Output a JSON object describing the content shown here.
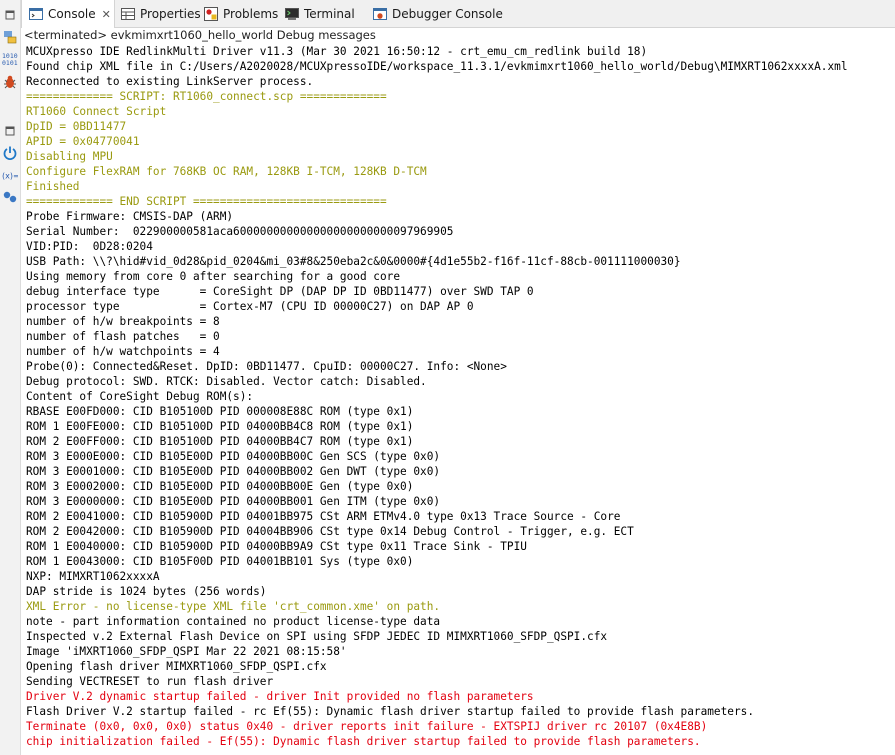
{
  "tabs": [
    {
      "label": "Console",
      "icon": "console-icon",
      "active": true
    },
    {
      "label": "Properties",
      "icon": "properties-icon"
    },
    {
      "label": "Problems",
      "icon": "problems-icon"
    },
    {
      "label": "Terminal",
      "icon": "terminal-icon"
    },
    {
      "label": "Debugger Console",
      "icon": "debugger-console-icon"
    }
  ],
  "console_title": "<terminated> evkmimxrt1060_hello_world Debug messages",
  "left_toolbar_icons": [
    "minimize-icon",
    "project-explorer-icon",
    "registers-icon",
    "debug-bug-icon",
    "minimize-icon",
    "power-icon",
    "variables-icon",
    "breakpoints-icon"
  ],
  "colors": {
    "normal": "#000000",
    "script": "#9a9a10",
    "error": "#e3000f"
  },
  "lines": [
    {
      "t": "MCUXpresso IDE RedlinkMulti Driver v11.3 (Mar 30 2021 16:50:12 - crt_emu_cm_redlink build 18)",
      "c": "normal"
    },
    {
      "t": "Found chip XML file in C:/Users/A2020028/MCUXpressoIDE/workspace_11.3.1/evkmimxrt1060_hello_world/Debug\\MIMXRT1062xxxxA.xml",
      "c": "normal"
    },
    {
      "t": "Reconnected to existing LinkServer process.",
      "c": "normal"
    },
    {
      "t": "============= SCRIPT: RT1060_connect.scp =============",
      "c": "script"
    },
    {
      "t": "RT1060 Connect Script",
      "c": "script"
    },
    {
      "t": "DpID = 0BD11477",
      "c": "script"
    },
    {
      "t": "APID = 0x04770041",
      "c": "script"
    },
    {
      "t": "Disabling MPU",
      "c": "script"
    },
    {
      "t": "Configure FlexRAM for 768KB OC RAM, 128KB I-TCM, 128KB D-TCM",
      "c": "script"
    },
    {
      "t": "Finished",
      "c": "script"
    },
    {
      "t": "============= END SCRIPT =============================",
      "c": "script"
    },
    {
      "t": "Probe Firmware: CMSIS-DAP (ARM)",
      "c": "normal"
    },
    {
      "t": "Serial Number:  022900000581aca600000000000000000000000097969905",
      "c": "normal"
    },
    {
      "t": "VID:PID:  0D28:0204",
      "c": "normal"
    },
    {
      "t": "USB Path: \\\\?\\hid#vid_0d28&pid_0204&mi_03#8&250eba2c&0&0000#{4d1e55b2-f16f-11cf-88cb-001111000030}",
      "c": "normal"
    },
    {
      "t": "Using memory from core 0 after searching for a good core",
      "c": "normal"
    },
    {
      "t": "debug interface type      = CoreSight DP (DAP DP ID 0BD11477) over SWD TAP 0",
      "c": "normal"
    },
    {
      "t": "processor type            = Cortex-M7 (CPU ID 00000C27) on DAP AP 0",
      "c": "normal"
    },
    {
      "t": "number of h/w breakpoints = 8",
      "c": "normal"
    },
    {
      "t": "number of flash patches   = 0",
      "c": "normal"
    },
    {
      "t": "number of h/w watchpoints = 4",
      "c": "normal"
    },
    {
      "t": "Probe(0): Connected&Reset. DpID: 0BD11477. CpuID: 00000C27. Info: <None>",
      "c": "normal"
    },
    {
      "t": "Debug protocol: SWD. RTCK: Disabled. Vector catch: Disabled.",
      "c": "normal"
    },
    {
      "t": "Content of CoreSight Debug ROM(s):",
      "c": "normal"
    },
    {
      "t": "RBASE E00FD000: CID B105100D PID 000008E88C ROM (type 0x1)",
      "c": "normal"
    },
    {
      "t": "ROM 1 E00FE000: CID B105100D PID 04000BB4C8 ROM (type 0x1)",
      "c": "normal"
    },
    {
      "t": "ROM 2 E00FF000: CID B105100D PID 04000BB4C7 ROM (type 0x1)",
      "c": "normal"
    },
    {
      "t": "ROM 3 E000E000: CID B105E00D PID 04000BB00C Gen SCS (type 0x0)",
      "c": "normal"
    },
    {
      "t": "ROM 3 E0001000: CID B105E00D PID 04000BB002 Gen DWT (type 0x0)",
      "c": "normal"
    },
    {
      "t": "ROM 3 E0002000: CID B105E00D PID 04000BB00E Gen (type 0x0)",
      "c": "normal"
    },
    {
      "t": "ROM 3 E0000000: CID B105E00D PID 04000BB001 Gen ITM (type 0x0)",
      "c": "normal"
    },
    {
      "t": "ROM 2 E0041000: CID B105900D PID 04001BB975 CSt ARM ETMv4.0 type 0x13 Trace Source - Core",
      "c": "normal"
    },
    {
      "t": "ROM 2 E0042000: CID B105900D PID 04004BB906 CSt type 0x14 Debug Control - Trigger, e.g. ECT",
      "c": "normal"
    },
    {
      "t": "ROM 1 E0040000: CID B105900D PID 04000BB9A9 CSt type 0x11 Trace Sink - TPIU",
      "c": "normal"
    },
    {
      "t": "ROM 1 E0043000: CID B105F00D PID 04001BB101 Sys (type 0x0)",
      "c": "normal"
    },
    {
      "t": "NXP: MIMXRT1062xxxxA",
      "c": "normal"
    },
    {
      "t": "DAP stride is 1024 bytes (256 words)",
      "c": "normal"
    },
    {
      "t": "XML Error - no license-type XML file 'crt_common.xme' on path.",
      "c": "script"
    },
    {
      "t": "note - part information contained no product license-type data",
      "c": "normal"
    },
    {
      "t": "Inspected v.2 External Flash Device on SPI using SFDP JEDEC ID MIMXRT1060_SFDP_QSPI.cfx",
      "c": "normal"
    },
    {
      "t": "Image 'iMXRT1060_SFDP_QSPI Mar 22 2021 08:15:58'",
      "c": "normal"
    },
    {
      "t": "Opening flash driver MIMXRT1060_SFDP_QSPI.cfx",
      "c": "normal"
    },
    {
      "t": "Sending VECTRESET to run flash driver",
      "c": "normal"
    },
    {
      "t": "Driver V.2 dynamic startup failed - driver Init provided no flash parameters",
      "c": "error"
    },
    {
      "t": "Flash Driver V.2 startup failed - rc Ef(55): Dynamic flash driver startup failed to provide flash parameters.",
      "c": "normal"
    },
    {
      "t": "Terminate (0x0, 0x0, 0x0) status 0x40 - driver reports init failure - EXTSPIJ driver rc 20107 (0x4E8B)",
      "c": "error"
    },
    {
      "t": "chip initialization failed - Ef(55): Dynamic flash driver startup failed to provide flash parameters.",
      "c": "error"
    }
  ]
}
